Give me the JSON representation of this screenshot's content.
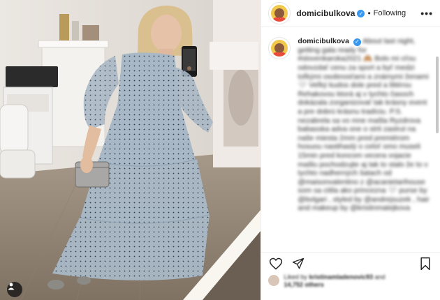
{
  "post": {
    "username": "domicibulkova",
    "verified_mark": "✓",
    "separator": "•",
    "follow_status": "Following",
    "more_label": "•••"
  },
  "caption": {
    "author": "domicibulkova",
    "text": "About last night, getting gala ready for #slovenkaroka2021 🙈 Bolo mi cťou odovzdať cenu za sport a byť medzi toľkými osobnosťami a známymi ženami 🤍 Veľký kudos dole pred a littérou Rehakovou ktorá aj v tychto časoch dokázala zorganizovať tak krásny event a pre dobrú krásnu tradíciu. P.S. nezabrela sa vo mne mašla Ryzdrova babasska adva one o strti zastrut na naše miesta 2mm pred premiérom hosuou nastihaslý o celoť omo museli 15min pred koncom vecera vojacie mašlu pochodzujte aj tak to stalo že to v tychto nadherných šatach od @maisonvalentino z @acanietarihouse som sa citila ako princezna 🤍 purse by @bvlgari , styled by @andrejsuzek , hair and makeup by @kristinmatejkova"
  },
  "likes": {
    "liked_by_prefix": "Liked by",
    "liked_by_user": "kristinamladenovic93",
    "and_label": "and",
    "others_count": "14,752 others"
  },
  "icons": {
    "heart": "heart-icon",
    "comment": "comment-icon",
    "share": "share-icon",
    "save": "bookmark-icon",
    "user_tag": "user-tag-icon",
    "more": "more-options-icon"
  },
  "colors": {
    "verified": "#3897f0",
    "mention": "#00376b",
    "border": "#efefef"
  }
}
